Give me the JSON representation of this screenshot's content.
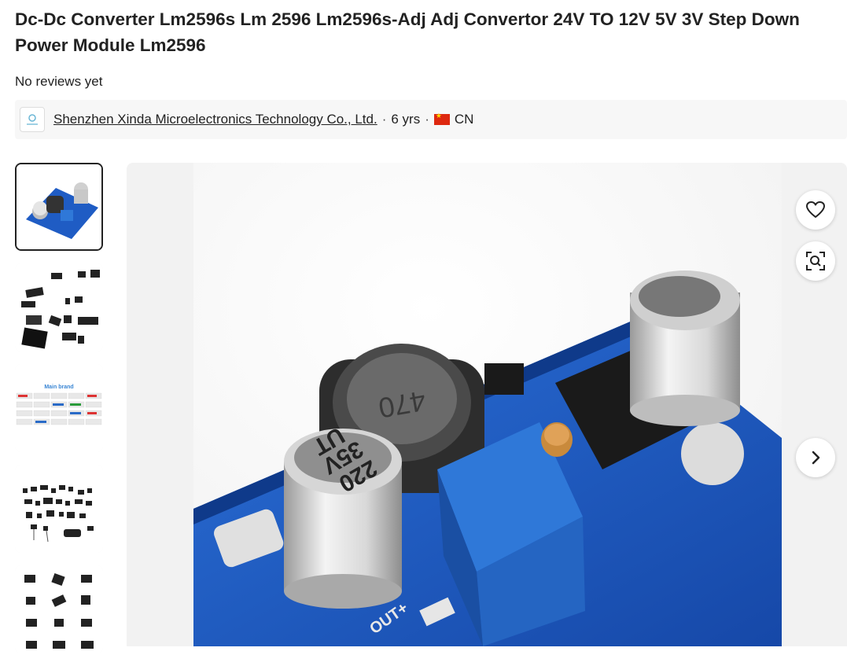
{
  "product": {
    "title": "Dc-Dc Converter Lm2596s Lm 2596 Lm2596s-Adj Adj Convertor 24V TO 12V 5V 3V Step Down Power Module Lm2596",
    "reviews": "No reviews yet"
  },
  "supplier": {
    "name": "Shenzhen Xinda Microelectronics Technology Co., Ltd.",
    "years": "6 yrs",
    "separator": "·",
    "country": "CN"
  },
  "gallery": {
    "thumbnails": [
      {
        "icon": "converter-module-thumbnail"
      },
      {
        "icon": "ic-chips-thumbnail"
      },
      {
        "icon": "main-brand-thumbnail",
        "label": "Main brand"
      },
      {
        "icon": "components-thumbnail"
      },
      {
        "icon": "ic-chips-grid-thumbnail"
      }
    ],
    "main_image": {
      "icon": "lm2596-module-photo",
      "cap_text_1": "220",
      "cap_text_2": "35V",
      "cap_text_3": "UT",
      "inductor_text": "470",
      "pcb_text": "OUT+"
    },
    "buttons": {
      "favorite": "heart-icon",
      "image_search": "image-search-icon",
      "next": "chevron-right-icon"
    }
  },
  "colors": {
    "pcb": "#1f5cc4",
    "pot": "#2f78d8",
    "text": "#222222",
    "cn_flag": "#de2910"
  }
}
